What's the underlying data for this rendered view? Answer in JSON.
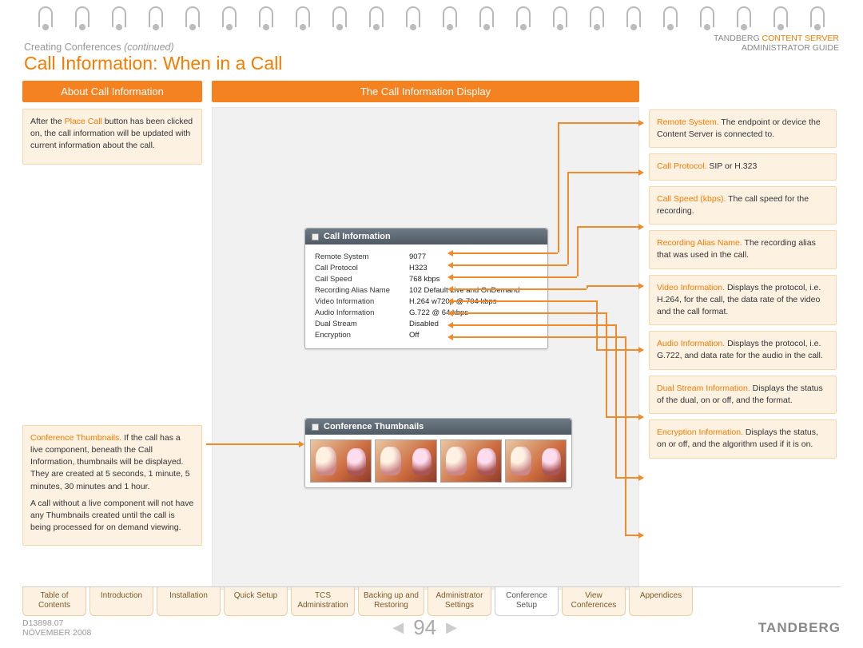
{
  "breadcrumb": {
    "section": "Creating Conferences",
    "suffix": "(continued)"
  },
  "page_title": "Call Information: When in a Call",
  "top_right": {
    "brand": "TANDBERG",
    "product": "CONTENT SERVER",
    "sub": "ADMINISTRATOR GUIDE"
  },
  "left": {
    "header": "About Call Information",
    "para1_a": "After the ",
    "para1_hl": "Place Call",
    "para1_b": " button has been clicked on, the call information will be updated with current information about the call.",
    "thumbs_hl": "Conference Thumbnails.",
    "thumbs_a": " If the call has a live component, beneath the Call Information, thumbnails will be displayed. They are created at 5 seconds, 1 minute, 5 minutes, 30 minutes and 1 hour.",
    "thumbs_b": "A call without a live component will not have any Thumbnails created until the call is being processed for on demand viewing."
  },
  "mid": {
    "header": "The Call Information Display",
    "info_title": "Call Information",
    "thumb_title": "Conference Thumbnails",
    "rows": [
      {
        "label": "Remote System",
        "value": "9077"
      },
      {
        "label": "Call Protocol",
        "value": "H323"
      },
      {
        "label": "Call Speed",
        "value": "768 kbps"
      },
      {
        "label": "Recording Alias Name",
        "value": "102 Default Live and OnDemand"
      },
      {
        "label": "Video Information",
        "value": "H.264 w720p @ 704 kbps"
      },
      {
        "label": "Audio Information",
        "value": "G.722 @ 64 kbps"
      },
      {
        "label": "Dual Stream",
        "value": "Disabled"
      },
      {
        "label": "Encryption",
        "value": "Off"
      }
    ]
  },
  "right": [
    {
      "hl": "Remote System.",
      "txt": " The endpoint or device the Content Server is connected to."
    },
    {
      "hl": "Call Protocol.",
      "txt": " SIP or H.323"
    },
    {
      "hl": "Call Speed (kbps).",
      "txt": " The call speed for the recording."
    },
    {
      "hl": "Recording Alias Name.",
      "txt": " The recording alias that was used in the call."
    },
    {
      "hl": "Video Information.",
      "txt": " Displays the protocol, i.e. H.264,  for the call, the data rate of the video and the call format."
    },
    {
      "hl": "Audio Information.",
      "txt": " Displays the protocol, i.e. G.722, and data rate for the audio in the call."
    },
    {
      "hl": "Dual Stream Information.",
      "txt": " Displays the status of the dual, on or off, and the format."
    },
    {
      "hl": "Encryption Information.",
      "txt": " Displays the status, on or off, and the algorithm used if it is on."
    }
  ],
  "tabs": [
    "Table of\nContents",
    "Introduction",
    "Installation",
    "Quick Setup",
    "TCS\nAdministration",
    "Backing up and\nRestoring",
    "Administrator\nSettings",
    "Conference\nSetup",
    "View\nConferences",
    "Appendices"
  ],
  "footer": {
    "doc": "D13898.07",
    "date": "NOVEMBER 2008",
    "page": "94",
    "brand": "TANDBERG"
  }
}
